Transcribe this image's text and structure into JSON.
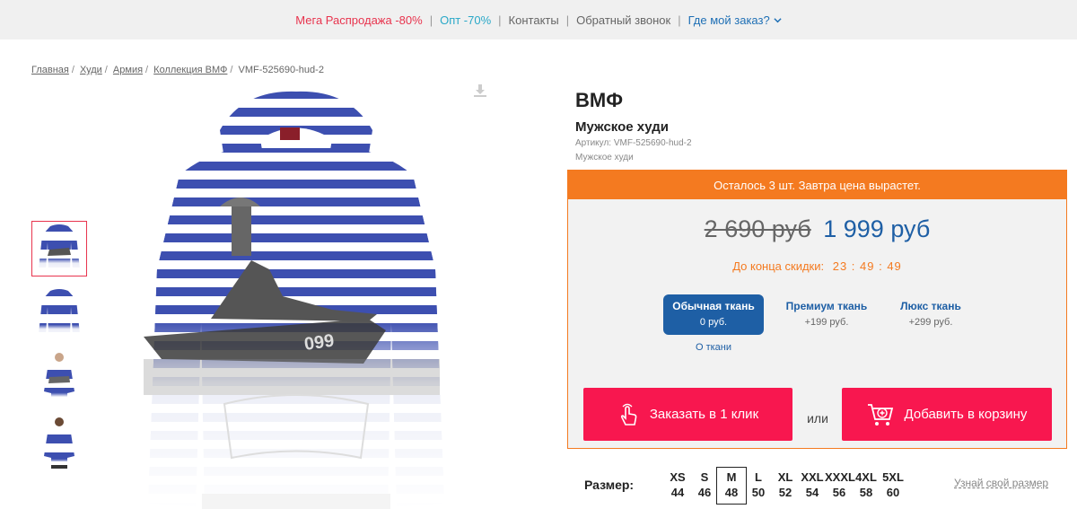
{
  "topbar": {
    "sale": "Мега Распродажа -80%",
    "wholesale": "Опт -70%",
    "contacts": "Контакты",
    "callback": "Обратный звонок",
    "order_status": "Где мой заказ?"
  },
  "breadcrumb": [
    "Главная",
    "Худи",
    "Армия",
    "Коллекция ВМФ"
  ],
  "breadcrumb_current": "VMF-525690-hud-2",
  "product": {
    "title": "ВМФ",
    "subtitle": "Мужское худи",
    "article": "Артикул: VMF-525690-hud-2",
    "category": "Мужское худи"
  },
  "price_box": {
    "urgency": "Осталось  3  шт. Завтра цена вырастет.",
    "old_price": "2 690 руб",
    "new_price": "1 999 руб",
    "countdown_label": "До конца скидки:",
    "countdown_time": "23 : 49 : 49",
    "fabrics": [
      {
        "name": "Обычная ткань",
        "price": "0 руб."
      },
      {
        "name": "Премиум ткань",
        "price": "+199 руб."
      },
      {
        "name": "Люкс ткань",
        "price": "+299 руб."
      }
    ],
    "about_fabric": "О ткани",
    "oneclick_label": "Заказать в 1 клик",
    "or_label": "или",
    "cart_label": "Добавить в корзину"
  },
  "sizes": {
    "label": "Размер:",
    "items": [
      {
        "letter": "XS",
        "num": "44"
      },
      {
        "letter": "S",
        "num": "46"
      },
      {
        "letter": "M",
        "num": "48"
      },
      {
        "letter": "L",
        "num": "50"
      },
      {
        "letter": "XL",
        "num": "52"
      },
      {
        "letter": "XXL",
        "num": "54"
      },
      {
        "letter": "XXXL",
        "num": "56"
      },
      {
        "letter": "4XL",
        "num": "58"
      },
      {
        "letter": "5XL",
        "num": "60"
      }
    ],
    "selected": "M",
    "guide": "Узнай свой размер"
  },
  "colors": {
    "accent_orange": "#f47a20",
    "button_red": "#f8174f",
    "blue": "#1e5fa5",
    "stripe_blue": "#3d4fb0"
  }
}
